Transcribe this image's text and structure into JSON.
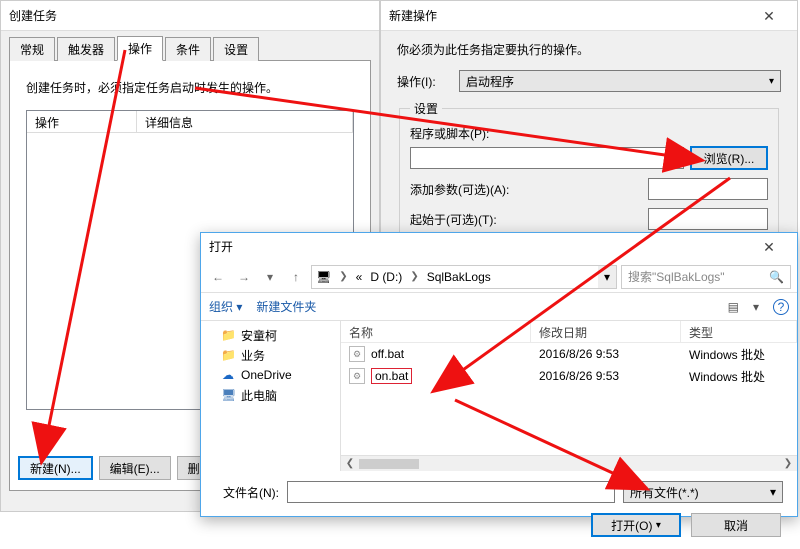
{
  "task_window": {
    "title": "创建任务",
    "tabs": [
      "常规",
      "触发器",
      "操作",
      "条件",
      "设置"
    ],
    "active_tab": 2,
    "hint": "创建任务时，必须指定任务启动时发生的操作。",
    "list_headers": {
      "col1": "操作",
      "col2": "详细信息"
    },
    "buttons": {
      "new": "新建(N)...",
      "edit": "编辑(E)...",
      "delete": "删"
    }
  },
  "action_window": {
    "title": "新建操作",
    "hint": "你必须为此任务指定要执行的操作。",
    "action_label": "操作(I):",
    "action_value": "启动程序",
    "settings_group": "设置",
    "program_label": "程序或脚本(P):",
    "browse_btn": "浏览(R)...",
    "addargs_label": "添加参数(可选)(A):",
    "startin_label": "起始于(可选)(T):"
  },
  "open_dialog": {
    "title": "打开",
    "nav": {
      "back": "←",
      "fwd": "→",
      "up": "↑",
      "recent": "▾",
      "pc_icon": "🖥",
      "drive": "D (D:)",
      "folder": "SqlBakLogs",
      "search_placeholder": "搜索\"SqlBakLogs\"",
      "refresh": "↻"
    },
    "toolbar": {
      "organize": "组织 ▾",
      "newfolder": "新建文件夹"
    },
    "tree": [
      {
        "icon": "📁",
        "cls": "folder-ico",
        "label": "安童柯"
      },
      {
        "icon": "📁",
        "cls": "folder-ico",
        "label": "业务"
      },
      {
        "icon": "☁",
        "cls": "onedrive-ico",
        "label": "OneDrive"
      },
      {
        "icon": "🖥",
        "cls": "pc-ico",
        "label": "此电脑"
      }
    ],
    "file_headers": {
      "name": "名称",
      "date": "修改日期",
      "type": "类型"
    },
    "files": [
      {
        "name": "off.bat",
        "date": "2016/8/26 9:53",
        "type": "Windows 批处"
      },
      {
        "name": "on.bat",
        "date": "2016/8/26 9:53",
        "type": "Windows 批处",
        "selected": true
      }
    ],
    "filename_label": "文件名(N):",
    "filter_value": "所有文件(*.*)",
    "open_btn": "打开(O)",
    "cancel_btn": "取消"
  },
  "icons": {
    "close": "✕",
    "search": "🔍",
    "views": "▤",
    "help": "?",
    "chev_down": "▾",
    "chev_right": "❯",
    "chev_left": "❮"
  }
}
